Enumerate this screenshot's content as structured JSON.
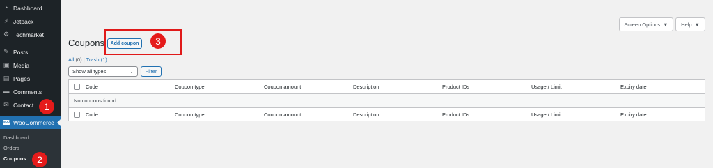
{
  "sidebar": {
    "items": [
      {
        "label": "Dashboard",
        "icon": "dashboard-icon",
        "glyph": "◔"
      },
      {
        "label": "Jetpack",
        "icon": "jetpack-icon",
        "glyph": "⚡"
      },
      {
        "label": "Techmarket",
        "icon": "gear-icon",
        "glyph": "⚙"
      },
      {
        "label": "Posts",
        "icon": "pin-icon",
        "glyph": "✎"
      },
      {
        "label": "Media",
        "icon": "media-icon",
        "glyph": "▣"
      },
      {
        "label": "Pages",
        "icon": "pages-icon",
        "glyph": "▤"
      },
      {
        "label": "Comments",
        "icon": "comments-icon",
        "glyph": "▬"
      },
      {
        "label": "Contact",
        "icon": "mail-icon",
        "glyph": "✉"
      },
      {
        "label": "WooCommerce",
        "icon": "woocommerce-icon",
        "glyph": "woo"
      }
    ],
    "submenu": [
      {
        "label": "Dashboard"
      },
      {
        "label": "Orders"
      },
      {
        "label": "Coupons"
      }
    ]
  },
  "markers": [
    "1",
    "2",
    "3"
  ],
  "header": {
    "screen_options": "Screen Options",
    "help": "Help"
  },
  "page": {
    "title": "Coupons",
    "add_button": "Add coupon",
    "filters": {
      "all_label": "All",
      "all_count": "(0)",
      "separator": "|",
      "trash_label": "Trash",
      "trash_count": "(1)"
    },
    "type_select": "Show all types",
    "filter_button": "Filter"
  },
  "table": {
    "columns": [
      "Code",
      "Coupon type",
      "Coupon amount",
      "Description",
      "Product IDs",
      "Usage / Limit",
      "Expiry date"
    ],
    "empty_message": "No coupons found"
  },
  "colors": {
    "sidebar_bg": "#1d2327",
    "accent": "#2271b1",
    "marker": "#e51b1b"
  }
}
